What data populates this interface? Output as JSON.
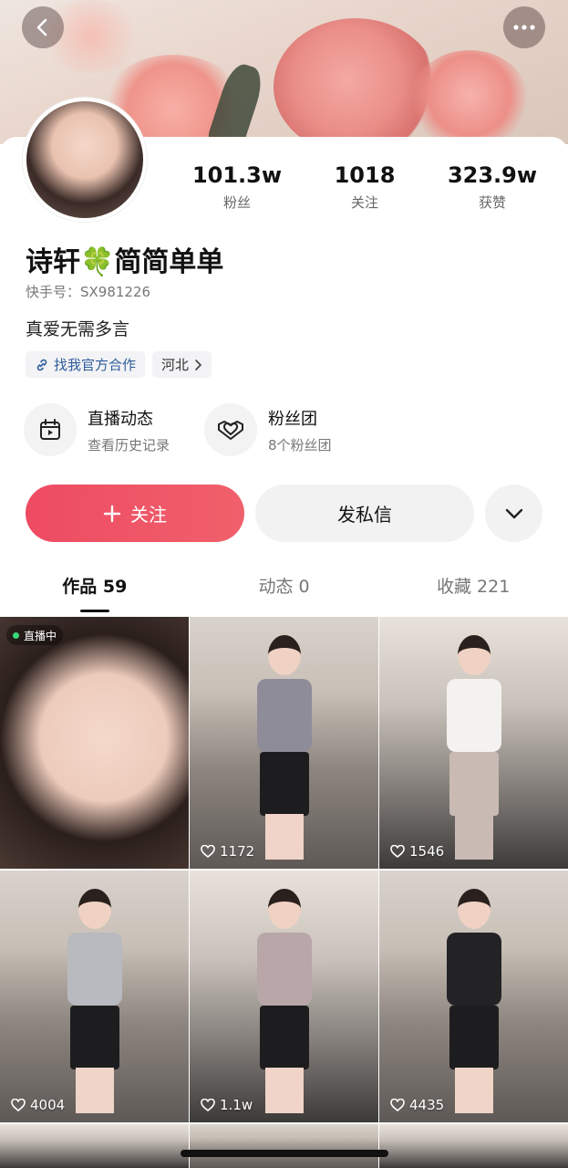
{
  "header": {
    "back_icon": "chevron-left-icon",
    "more_icon": "more-dots-icon"
  },
  "stats": [
    {
      "value": "101.3w",
      "label": "粉丝"
    },
    {
      "value": "1018",
      "label": "关注"
    },
    {
      "value": "323.9w",
      "label": "获赞"
    }
  ],
  "profile": {
    "name": "诗轩🍀简简单单",
    "kuaishou_id": "快手号：SX981226",
    "bio": "真爱无需多言",
    "tags": [
      {
        "label": "找我官方合作",
        "icon": "link-icon"
      },
      {
        "label": "河北",
        "icon": "chevron-right-icon"
      }
    ]
  },
  "entries": [
    {
      "title": "直播动态",
      "subtitle": "查看历史记录",
      "icon": "calendar-play-icon"
    },
    {
      "title": "粉丝团",
      "subtitle": "8个粉丝团",
      "icon": "heart-badge-icon"
    }
  ],
  "actions": {
    "follow_label": "关注",
    "message_label": "发私信",
    "more_icon": "chevron-down-icon"
  },
  "tabs": [
    {
      "label": "作品 59",
      "active": true
    },
    {
      "label": "动态 0",
      "active": false
    },
    {
      "label": "收藏 221",
      "active": false
    }
  ],
  "grid": [
    {
      "badge": "直播中",
      "likes": ""
    },
    {
      "badge": "",
      "likes": "1172"
    },
    {
      "badge": "",
      "likes": "1546"
    },
    {
      "badge": "",
      "likes": "4004"
    },
    {
      "badge": "",
      "likes": "1.1w"
    },
    {
      "badge": "",
      "likes": "4435"
    }
  ],
  "colors": {
    "accent": "#ee4b62",
    "link": "#2f5d9e",
    "live": "#37d67a"
  }
}
